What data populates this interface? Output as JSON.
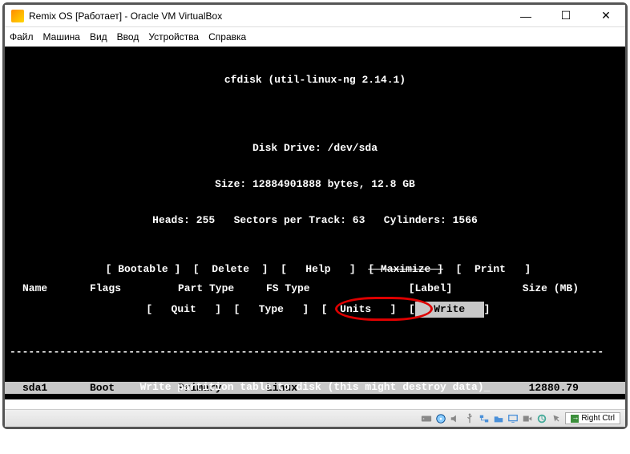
{
  "window": {
    "title": "Remix OS [Работает] - Oracle VM VirtualBox",
    "min": "—",
    "max": "☐",
    "close": "✕"
  },
  "menubar": [
    "Файл",
    "Машина",
    "Вид",
    "Ввод",
    "Устройства",
    "Справка"
  ],
  "term": {
    "l1": "cfdisk (util-linux-ng 2.14.1)",
    "l2": "Disk Drive: /dev/sda",
    "l3": "Size: 12884901888 bytes, 12.8 GB",
    "l4": "Heads: 255   Sectors per Track: 63   Cylinders: 1566",
    "hdr_name": "Name",
    "hdr_flags": "Flags",
    "hdr_ptype": "Part Type",
    "hdr_fstype": "FS Type",
    "hdr_label": "[Label]",
    "hdr_size": "Size (MB)",
    "r_name": "sda1",
    "r_flags": "Boot",
    "r_ptype": "Primary",
    "r_fstype": "Linux",
    "r_size": "12880.79",
    "menu1_a": " [ Bootable ]  [  Delete  ]  [   Help   ]  ",
    "menu1_b": "[ Maximize ]",
    "menu1_c": "  [  Print   ]",
    "menu2_a": " [   Quit   ]  [   Type   ]  [  Units   ]  ",
    "menu2_write_l": "[",
    "menu2_write": "   Write   ",
    "menu2_write_r": "]",
    "hint": "Write partition table to disk (this might destroy data)_"
  },
  "statusbar": {
    "hostkey": "Right Ctrl"
  }
}
